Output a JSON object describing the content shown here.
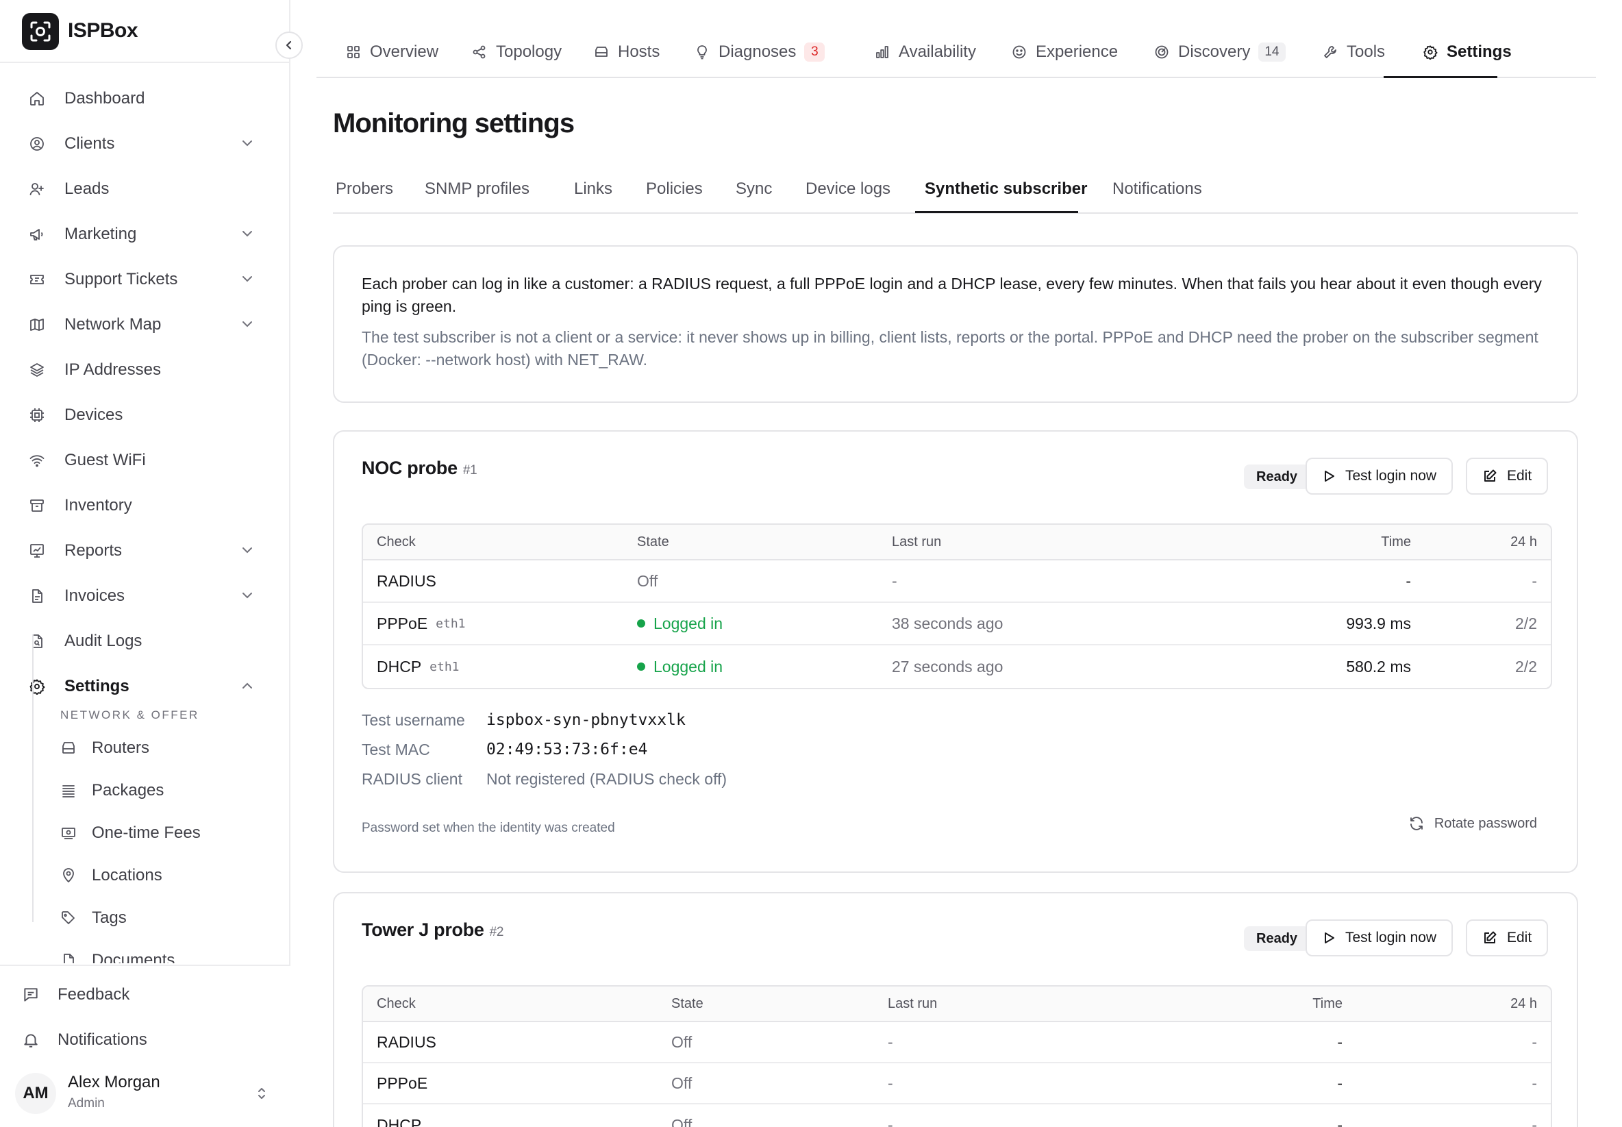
{
  "app": {
    "name": "ISPBox"
  },
  "sidebar": {
    "items": [
      {
        "label": "Dashboard",
        "icon": "home-icon"
      },
      {
        "label": "Clients",
        "icon": "user-circle-icon",
        "expandable": true
      },
      {
        "label": "Leads",
        "icon": "user-plus-icon"
      },
      {
        "label": "Marketing",
        "icon": "megaphone-icon",
        "expandable": true
      },
      {
        "label": "Support Tickets",
        "icon": "ticket-icon",
        "expandable": true
      },
      {
        "label": "Network Map",
        "icon": "map-icon",
        "expandable": true
      },
      {
        "label": "IP Addresses",
        "icon": "layers-icon"
      },
      {
        "label": "Devices",
        "icon": "chip-icon"
      },
      {
        "label": "Guest WiFi",
        "icon": "wifi-icon"
      },
      {
        "label": "Inventory",
        "icon": "archive-icon"
      },
      {
        "label": "Reports",
        "icon": "report-icon",
        "expandable": true
      },
      {
        "label": "Invoices",
        "icon": "file-icon",
        "expandable": true
      },
      {
        "label": "Audit Logs",
        "icon": "audit-icon"
      },
      {
        "label": "Settings",
        "icon": "gear-icon",
        "expanded": true,
        "active": true
      }
    ],
    "section_label": "NETWORK & OFFER",
    "sub_items": [
      {
        "label": "Routers",
        "icon": "router-icon"
      },
      {
        "label": "Packages",
        "icon": "stack-icon"
      },
      {
        "label": "One-time Fees",
        "icon": "banknote-icon"
      },
      {
        "label": "Locations",
        "icon": "pin-icon"
      },
      {
        "label": "Tags",
        "icon": "tag-icon"
      },
      {
        "label": "Documents",
        "icon": "document-icon"
      }
    ],
    "bottom": {
      "feedback": "Feedback",
      "notifications": "Notifications"
    },
    "user": {
      "initials": "AM",
      "name": "Alex Morgan",
      "role": "Admin"
    }
  },
  "topnav": {
    "tabs": [
      {
        "label": "Overview",
        "icon": "grid-icon"
      },
      {
        "label": "Topology",
        "icon": "share-icon"
      },
      {
        "label": "Hosts",
        "icon": "server-icon"
      },
      {
        "label": "Diagnoses",
        "icon": "lightbulb-icon",
        "badge": "3",
        "badge_tone": "red"
      },
      {
        "label": "Availability",
        "icon": "bar-chart-icon"
      },
      {
        "label": "Experience",
        "icon": "smile-icon"
      },
      {
        "label": "Discovery",
        "icon": "radar-icon",
        "badge": "14",
        "badge_tone": "gray"
      },
      {
        "label": "Tools",
        "icon": "wrench-icon"
      },
      {
        "label": "Settings",
        "icon": "gear-icon",
        "active": true
      }
    ]
  },
  "page": {
    "title": "Monitoring settings",
    "subtabs": [
      "Probers",
      "SNMP profiles",
      "Links",
      "Policies",
      "Sync",
      "Device logs",
      "Synthetic subscriber",
      "Notifications"
    ],
    "active_subtab": "Synthetic subscriber"
  },
  "intro": {
    "p1": "Each prober can log in like a customer: a RADIUS request, a full PPPoE login and a DHCP lease, every few minutes. When that fails you hear about it even though every ping is green.",
    "p2": "The test subscriber is not a client or a service: it never shows up in billing, client lists, reports or the portal. PPPoE and DHCP need the prober on the subscriber segment (Docker: --network host) with NET_RAW."
  },
  "probes": [
    {
      "name": "NOC probe",
      "number": "#1",
      "status": "Ready",
      "test_button": "Test login now",
      "edit_button": "Edit",
      "columns": [
        "Check",
        "State",
        "Last run",
        "Time",
        "24 h"
      ],
      "rows": [
        {
          "check": "RADIUS",
          "iface": "",
          "state": "Off",
          "ok": false,
          "last_run": "-",
          "time": "-",
          "h24": "-"
        },
        {
          "check": "PPPoE",
          "iface": "eth1",
          "state": "Logged in",
          "ok": true,
          "last_run": "38 seconds ago",
          "time": "993.9 ms",
          "h24": "2/2"
        },
        {
          "check": "DHCP",
          "iface": "eth1",
          "state": "Logged in",
          "ok": true,
          "last_run": "27 seconds ago",
          "time": "580.2 ms",
          "h24": "2/2"
        }
      ],
      "details": {
        "username_label": "Test username",
        "username": "ispbox-syn-pbnytvxxlk",
        "mac_label": "Test MAC",
        "mac": "02:49:53:73:6f:e4",
        "radius_label": "RADIUS client",
        "radius": "Not registered (RADIUS check off)"
      },
      "password_note": "Password set when the identity was created",
      "rotate_label": "Rotate password"
    },
    {
      "name": "Tower J probe",
      "number": "#2",
      "status": "Ready",
      "test_button": "Test login now",
      "edit_button": "Edit",
      "columns": [
        "Check",
        "State",
        "Last run",
        "Time",
        "24 h"
      ],
      "rows": [
        {
          "check": "RADIUS",
          "state": "Off",
          "last_run": "-",
          "time": "-",
          "h24": "-"
        },
        {
          "check": "PPPoE",
          "state": "Off",
          "last_run": "-",
          "time": "-",
          "h24": "-"
        },
        {
          "check": "DHCP",
          "state": "Off",
          "last_run": "-",
          "time": "-",
          "h24": "-"
        }
      ]
    }
  ],
  "colors": {
    "accent": "#18181b",
    "ok": "#16a34a",
    "badge_red": "#dc2626"
  }
}
